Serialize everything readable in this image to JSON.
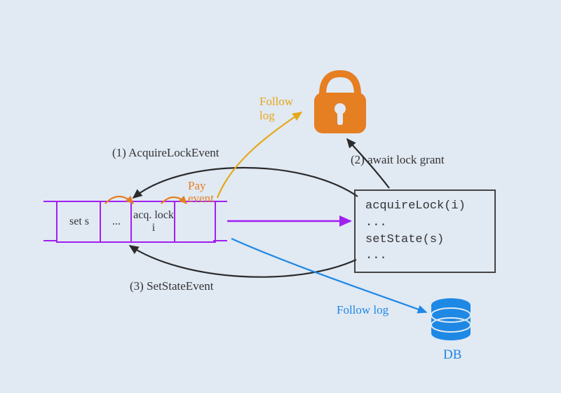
{
  "labels": {
    "step1": "(1) AcquireLockEvent",
    "step2": "(2) await lock grant",
    "step3": "(3) SetStateEvent",
    "followLogTop": "Follow\nlog",
    "followLogBottom": "Follow log",
    "payEvent": "Pay\nevent",
    "dbLabel": "DB"
  },
  "cells": {
    "c0": "set s",
    "c1": "...",
    "c2": "acq.\nlock i",
    "c3": ""
  },
  "code": {
    "l0": "acquireLock(i)",
    "l1": "...",
    "l2": "setState(s)",
    "l3": "..."
  },
  "colors": {
    "purple": "#A020F0",
    "orange": "#E67E22",
    "amber": "#E6A817",
    "blue": "#1E88E5",
    "black": "#2B2B2B"
  }
}
